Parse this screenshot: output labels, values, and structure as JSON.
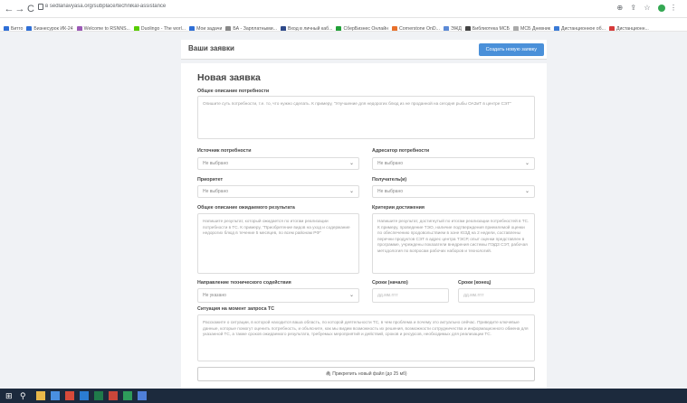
{
  "browser": {
    "url": "в sedlanavyasa.org/subplace/technikal-assistance",
    "bookmarks": [
      {
        "label": "Битго",
        "color": "#2f6fd6"
      },
      {
        "label": "Бизнесурок ИК-24",
        "color": "#2f6fd6"
      },
      {
        "label": "Welcome to RSNNS...",
        "color": "#9b59b6"
      },
      {
        "label": "Duolingo - The worl...",
        "color": "#58cc02"
      },
      {
        "label": "Мои задачи",
        "color": "#2f6fd6"
      },
      {
        "label": "БА - Зарплатными...",
        "color": "#888888"
      },
      {
        "label": "Вход в личный каб...",
        "color": "#2f4a8a"
      },
      {
        "label": "СберБизнес Онлайн",
        "color": "#21a038"
      },
      {
        "label": "Cornerstone OnD...",
        "color": "#e8712c"
      },
      {
        "label": "ЭЖД",
        "color": "#5c8ad6"
      },
      {
        "label": "Библиотека МСБ",
        "color": "#444444"
      },
      {
        "label": "МСБ Дневник",
        "color": "#aaaaaa"
      },
      {
        "label": "Дистанционное об...",
        "color": "#3a7ad6"
      },
      {
        "label": "Дистанционн...",
        "color": "#d63a3a"
      }
    ]
  },
  "header": {
    "title": "Ваши заявки",
    "create_button": "Создать новую заявку"
  },
  "form": {
    "title": "Новая заявка",
    "description": {
      "label": "Общее описание потребности",
      "placeholder": "Опишите суть потребности, т.е. то, что нужно сделать. К примеру, \"Улучшение для недорогих блюд из не проданной на сегодня рыбы ОАЗиТ в центре СЭТ\""
    },
    "source": {
      "label": "Источник потребности",
      "value": "Не выбрано"
    },
    "addressee": {
      "label": "Адресатор потребности",
      "value": "Не выбрано"
    },
    "priority": {
      "label": "Приоритет",
      "value": "Не выбрано"
    },
    "recipient": {
      "label": "Получатель(и)",
      "value": "Не выбрано"
    },
    "expected_result": {
      "label": "Общее описание ожидаемого результата",
      "placeholder": "Напишите результат, который ожидается по итогам реализации потребности в ТС. К примеру, \"Приобретение видов на уход и содержание недорогих блюд в течение 5 месяцев, по всем районам РФ\""
    },
    "criteria": {
      "label": "Критерии достижения",
      "placeholder": "Напишите результат, достигнутый по итогам реализации потребностей в ТС. К примеру, проведение ТЭО, наличие подтверждения приемлемой оценки по обеспечению продовольствием в зоне ЮЗД на 2 недели, составлены перечни продуктов СЭТ в адрес центра ТЭСР, опыт оценки представлен в программе, учреждены показатели внедрения системы ПЭДЗ СЭТ, рабочая методология по вопросам рабочих наборов и технологий."
    },
    "direction": {
      "label": "Направление технического содействия",
      "value": "Не указано"
    },
    "date_start": {
      "label": "Сроки (начало)",
      "placeholder": "дд.мм.гггг"
    },
    "date_end": {
      "label": "Сроки (конец)",
      "placeholder": "дд.мм.гггг"
    },
    "situation": {
      "label": "Ситуация на момент запроса ТС",
      "placeholder": "Расскажите о ситуации, в которой находится ваша область, по которой деятельности ТС, в чем проблема и почему это актуально сейчас. Приведите ключевые данные, которые помогут оценить потребность, и объясните, как мы видим возможность их решения, возможности сотрудничества и информационного обмена для указанной ТС, а также сроков ожидаемого результата, требуемых мероприятий и действий, сроков и ресурсов, необходимых для реализации ТС."
    },
    "upload_button": "Прикрепить новый файл (до 25 мб)"
  }
}
